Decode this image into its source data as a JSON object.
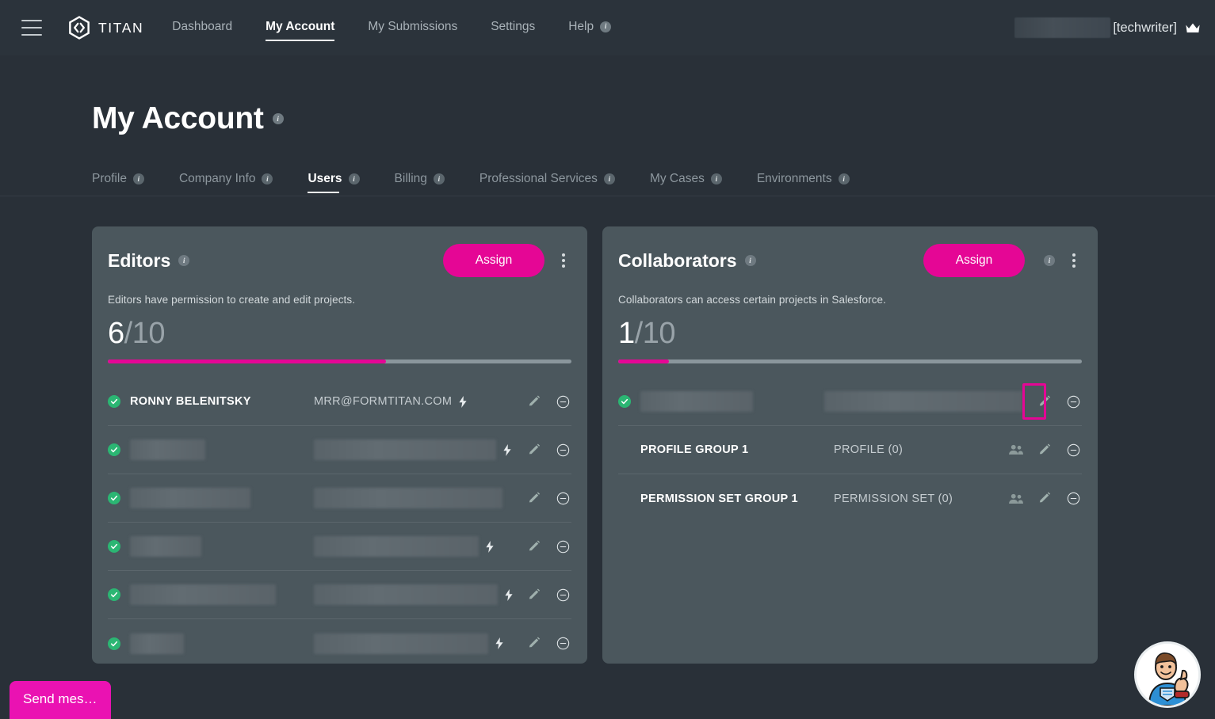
{
  "topnav": {
    "menu_icon": "hamburger-icon",
    "brand": "TITAN",
    "links": [
      {
        "label": "Dashboard",
        "active": false,
        "info": false
      },
      {
        "label": "My Account",
        "active": true,
        "info": false
      },
      {
        "label": "My Submissions",
        "active": false,
        "info": false
      },
      {
        "label": "Settings",
        "active": false,
        "info": false
      },
      {
        "label": "Help",
        "active": false,
        "info": true
      }
    ],
    "user_tag": "[techwriter]",
    "crown_icon": "crown-icon"
  },
  "page": {
    "title": "My Account",
    "title_info": "i",
    "tabs": [
      {
        "label": "Profile",
        "active": false
      },
      {
        "label": "Company Info",
        "active": false
      },
      {
        "label": "Users",
        "active": true
      },
      {
        "label": "Billing",
        "active": false
      },
      {
        "label": "Professional Services",
        "active": false
      },
      {
        "label": "My Cases",
        "active": false
      },
      {
        "label": "Environments",
        "active": false
      }
    ]
  },
  "editors_card": {
    "title": "Editors",
    "assign_label": "Assign",
    "description": "Editors have permission to create and edit projects.",
    "count_current": "6",
    "count_total": "/10",
    "progress_percent": 60,
    "rows": [
      {
        "name": "RONNY BELENITSKY",
        "sub": "MRR@FORMTITAN.COM",
        "redacted": false,
        "bolt": true
      },
      {
        "name": "",
        "sub": "",
        "redacted": true,
        "bolt": true,
        "name_w": 95,
        "sub_w": 230
      },
      {
        "name": "",
        "sub": "",
        "redacted": true,
        "bolt": false,
        "name_w": 152,
        "sub_w": 238
      },
      {
        "name": "",
        "sub": "",
        "redacted": true,
        "bolt": true,
        "name_w": 90,
        "sub_w": 208
      },
      {
        "name": "",
        "sub": "",
        "redacted": true,
        "bolt": true,
        "name_w": 184,
        "sub_w": 232
      },
      {
        "name": "",
        "sub": "",
        "redacted": true,
        "bolt": true,
        "name_w": 68,
        "sub_w": 220
      }
    ]
  },
  "collaborators_card": {
    "title": "Collaborators",
    "assign_label": "Assign",
    "header_info": "i",
    "description": "Collaborators can access certain projects in Salesforce.",
    "count_current": "1",
    "count_total": "/10",
    "progress_percent": 11,
    "rows": [
      {
        "name": "",
        "sub": "",
        "redacted": true,
        "check": true,
        "group": false,
        "highlight_edit": true,
        "name_w": 142,
        "sub_w": 250
      },
      {
        "name": "PROFILE GROUP 1",
        "sub": "PROFILE (0)",
        "redacted": false,
        "check": false,
        "group": true,
        "highlight_edit": false
      },
      {
        "name": "PERMISSION SET GROUP 1",
        "sub": "PERMISSION SET (0)",
        "redacted": false,
        "check": false,
        "group": true,
        "highlight_edit": false
      }
    ]
  },
  "chat": {
    "send_message_label": "Send mes…",
    "avatar_name": "support-mascot-avatar"
  },
  "colors": {
    "accent": "#E50695",
    "page_bg": "#293038",
    "nav_bg": "#2b333b",
    "card_bg": "#4b575d",
    "success": "#2BB673",
    "highlight": "#E50695"
  }
}
